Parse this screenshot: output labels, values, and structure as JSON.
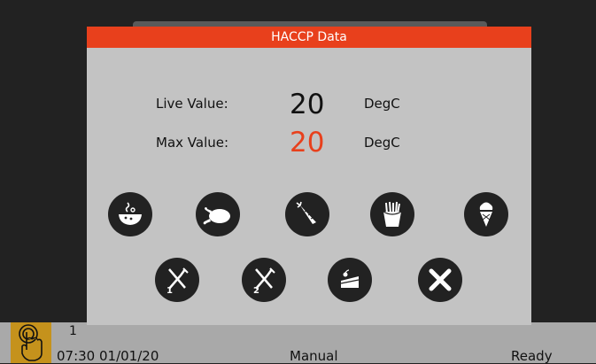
{
  "dialog": {
    "title": "HACCP Data",
    "live_label": "Live Value:",
    "live_value": "20",
    "live_unit": "DegC",
    "max_label": "Max Value:",
    "max_value": "20",
    "max_unit": "DegC",
    "colors": {
      "header": "#e8401c",
      "max_value": "#e8401c",
      "panel": "#c3c3c3",
      "button": "#222222"
    },
    "buttons_row1": [
      "soup-bowl-icon",
      "roast-chicken-icon",
      "carrot-icon",
      "fries-icon",
      "ice-cream-icon"
    ],
    "buttons_row2": [
      {
        "icon": "cutlery-icon",
        "badge": "1"
      },
      {
        "icon": "cutlery-icon",
        "badge": "2"
      },
      {
        "icon": "cake-slice-icon"
      },
      {
        "icon": "close-icon"
      }
    ]
  },
  "statusbar": {
    "number": "1",
    "datetime": "07:30  01/01/20",
    "mode": "Manual",
    "state": "Ready",
    "touch_icon": "touch-hand-icon"
  }
}
